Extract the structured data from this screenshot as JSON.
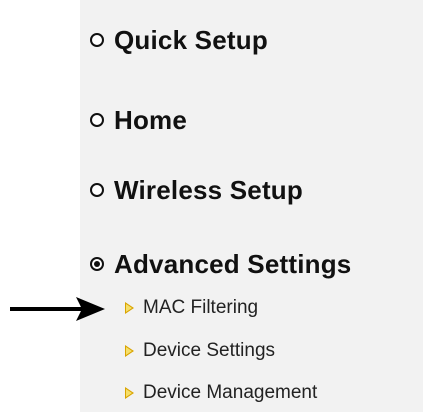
{
  "menu": {
    "items": [
      {
        "label": "Quick Setup",
        "selected": false,
        "icon": "radio-empty-icon"
      },
      {
        "label": "Home",
        "selected": false,
        "icon": "radio-empty-icon"
      },
      {
        "label": "Wireless Setup",
        "selected": false,
        "icon": "radio-empty-icon"
      },
      {
        "label": "Advanced Settings",
        "selected": true,
        "icon": "radio-selected-icon"
      }
    ],
    "submenu": [
      {
        "label": "MAC Filtering",
        "icon": "triangle-right-icon"
      },
      {
        "label": "Device Settings",
        "icon": "triangle-right-icon"
      },
      {
        "label": "Device Management",
        "icon": "triangle-right-icon"
      }
    ]
  },
  "annotation": {
    "icon": "arrow-right-icon",
    "color": "#000000"
  },
  "colors": {
    "panel_background": "#f2f2f2",
    "submenu_triangle": "#d9a400"
  }
}
